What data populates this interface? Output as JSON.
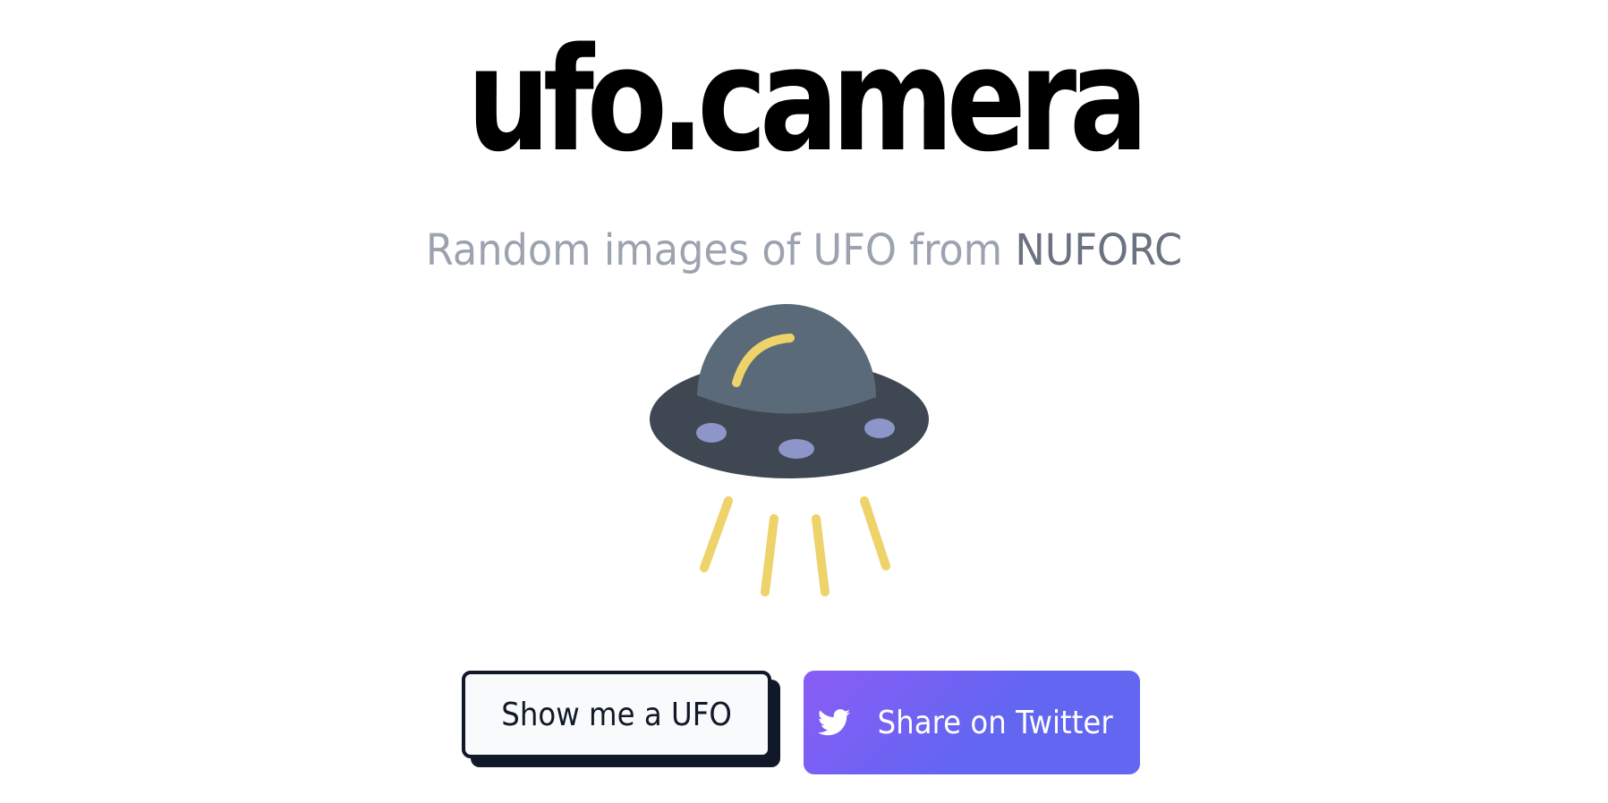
{
  "header": {
    "title": "ufo.camera",
    "tagline_prefix": "Random images of UFO from",
    "tagline_source": "NUFORC"
  },
  "illustration": {
    "icon": "ufo-icon",
    "colors": {
      "saucer": "#3f4852",
      "dome": "#5b6a78",
      "lights": "#8e95c9",
      "beams": "#eed36a"
    }
  },
  "actions": {
    "show_label": "Show me a UFO",
    "share_label": "Share on Twitter",
    "share_icon": "twitter-icon"
  },
  "colors": {
    "title": "#000000",
    "tagline": "#9ca3af",
    "tagline_source": "#6b7280",
    "button_dark": "#111827",
    "twitter_gradient_start": "#8b5cf6",
    "twitter_gradient_end": "#6366f1"
  }
}
